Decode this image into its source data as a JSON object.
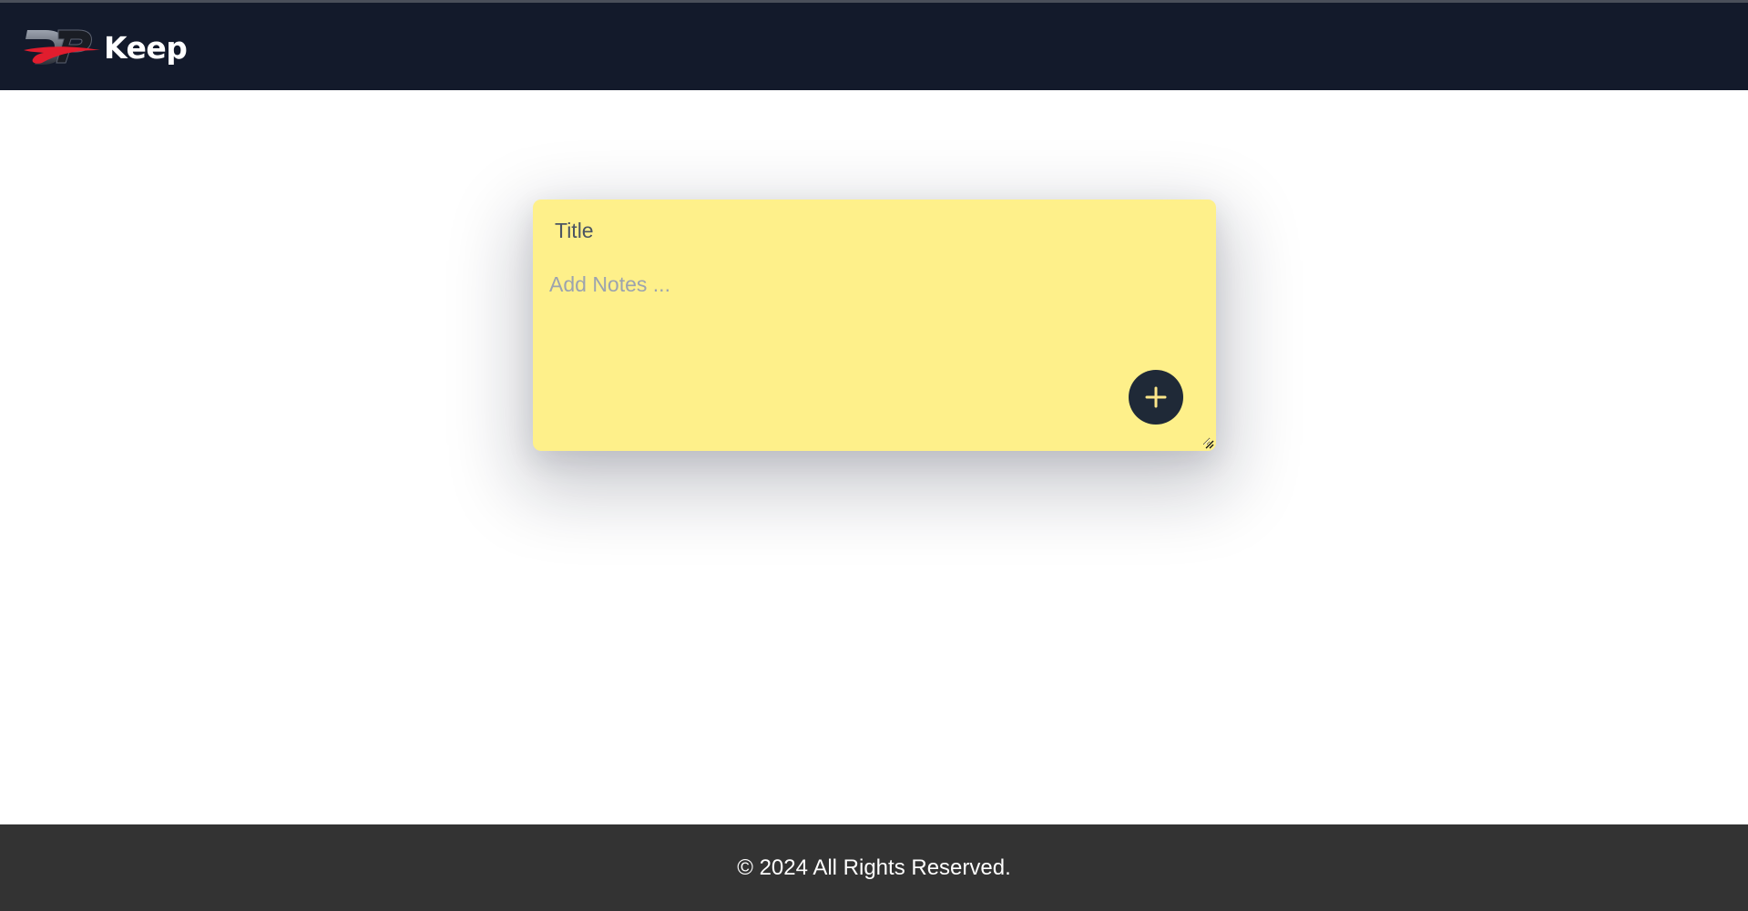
{
  "header": {
    "brand_name": "Keep",
    "logo_icon": "dp-logo-icon",
    "background": "#131a2b"
  },
  "note_form": {
    "title_placeholder": "Title",
    "title_value": "",
    "notes_placeholder": "Add Notes ...",
    "notes_value": "",
    "add_button_icon": "plus-icon",
    "card_color": "#fef08a",
    "button_color": "#1f2937"
  },
  "footer": {
    "text": "© 2024 All Rights Reserved.",
    "background": "#333333"
  }
}
